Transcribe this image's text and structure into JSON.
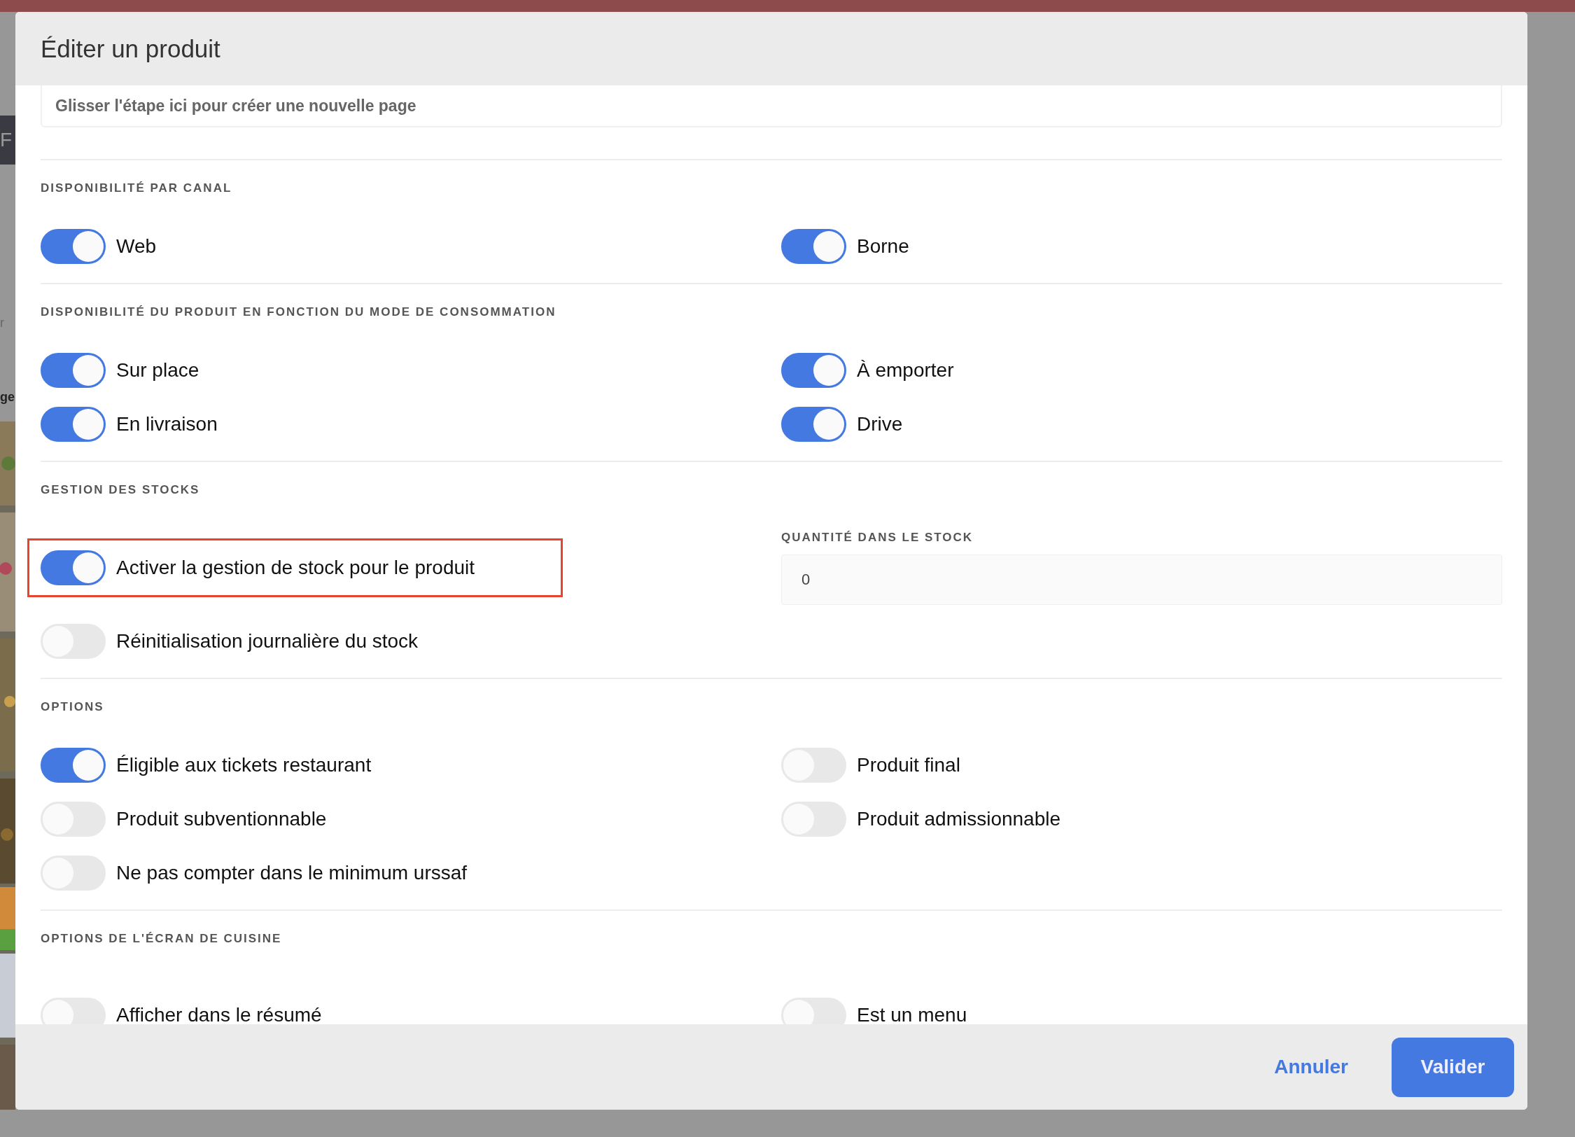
{
  "background": {
    "fragments": [
      {
        "text": "F",
        "kind": "tab"
      },
      {
        "text": "r",
        "kind": "plain"
      },
      {
        "text": "ge",
        "kind": "bold"
      }
    ]
  },
  "dialog": {
    "title": "Éditer un produit",
    "dropzone": "Glisser l'étape ici pour créer une nouvelle page",
    "sections": [
      {
        "heading": "DISPONIBILITÉ PAR CANAL",
        "items": [
          {
            "kind": "toggle",
            "label": "Web",
            "on": true
          },
          {
            "kind": "toggle",
            "label": "Borne",
            "on": true
          }
        ]
      },
      {
        "heading": "DISPONIBILITÉ DU PRODUIT EN FONCTION DU MODE DE CONSOMMATION",
        "items": [
          {
            "kind": "toggle",
            "label": "Sur place",
            "on": true
          },
          {
            "kind": "toggle",
            "label": "À emporter",
            "on": true
          },
          {
            "kind": "toggle",
            "label": "En livraison",
            "on": true
          },
          {
            "kind": "toggle",
            "label": "Drive",
            "on": true
          }
        ]
      },
      {
        "heading": "GESTION DES STOCKS",
        "items": [
          {
            "kind": "toggle",
            "label": "Activer la gestion de stock pour le produit",
            "on": true,
            "highlighted": true
          },
          {
            "kind": "field",
            "label": "QUANTITÉ DANS LE STOCK",
            "value": "0"
          },
          {
            "kind": "toggle",
            "label": "Réinitialisation journalière du stock",
            "on": false
          }
        ]
      },
      {
        "heading": "OPTIONS",
        "items": [
          {
            "kind": "toggle",
            "label": "Éligible aux tickets restaurant",
            "on": true
          },
          {
            "kind": "toggle",
            "label": "Produit final",
            "on": false
          },
          {
            "kind": "toggle",
            "label": "Produit subventionnable",
            "on": false
          },
          {
            "kind": "toggle",
            "label": "Produit admissionnable",
            "on": false
          },
          {
            "kind": "toggle",
            "label": "Ne pas compter dans le minimum urssaf",
            "on": false
          }
        ]
      },
      {
        "heading": "OPTIONS DE L'ÉCRAN DE CUISINE",
        "items": [
          {
            "kind": "toggle",
            "label": "Afficher dans le résumé",
            "on": false
          },
          {
            "kind": "toggle",
            "label": "Est un menu",
            "on": false
          }
        ]
      }
    ],
    "footer": {
      "cancel": "Annuler",
      "confirm": "Valider"
    }
  }
}
